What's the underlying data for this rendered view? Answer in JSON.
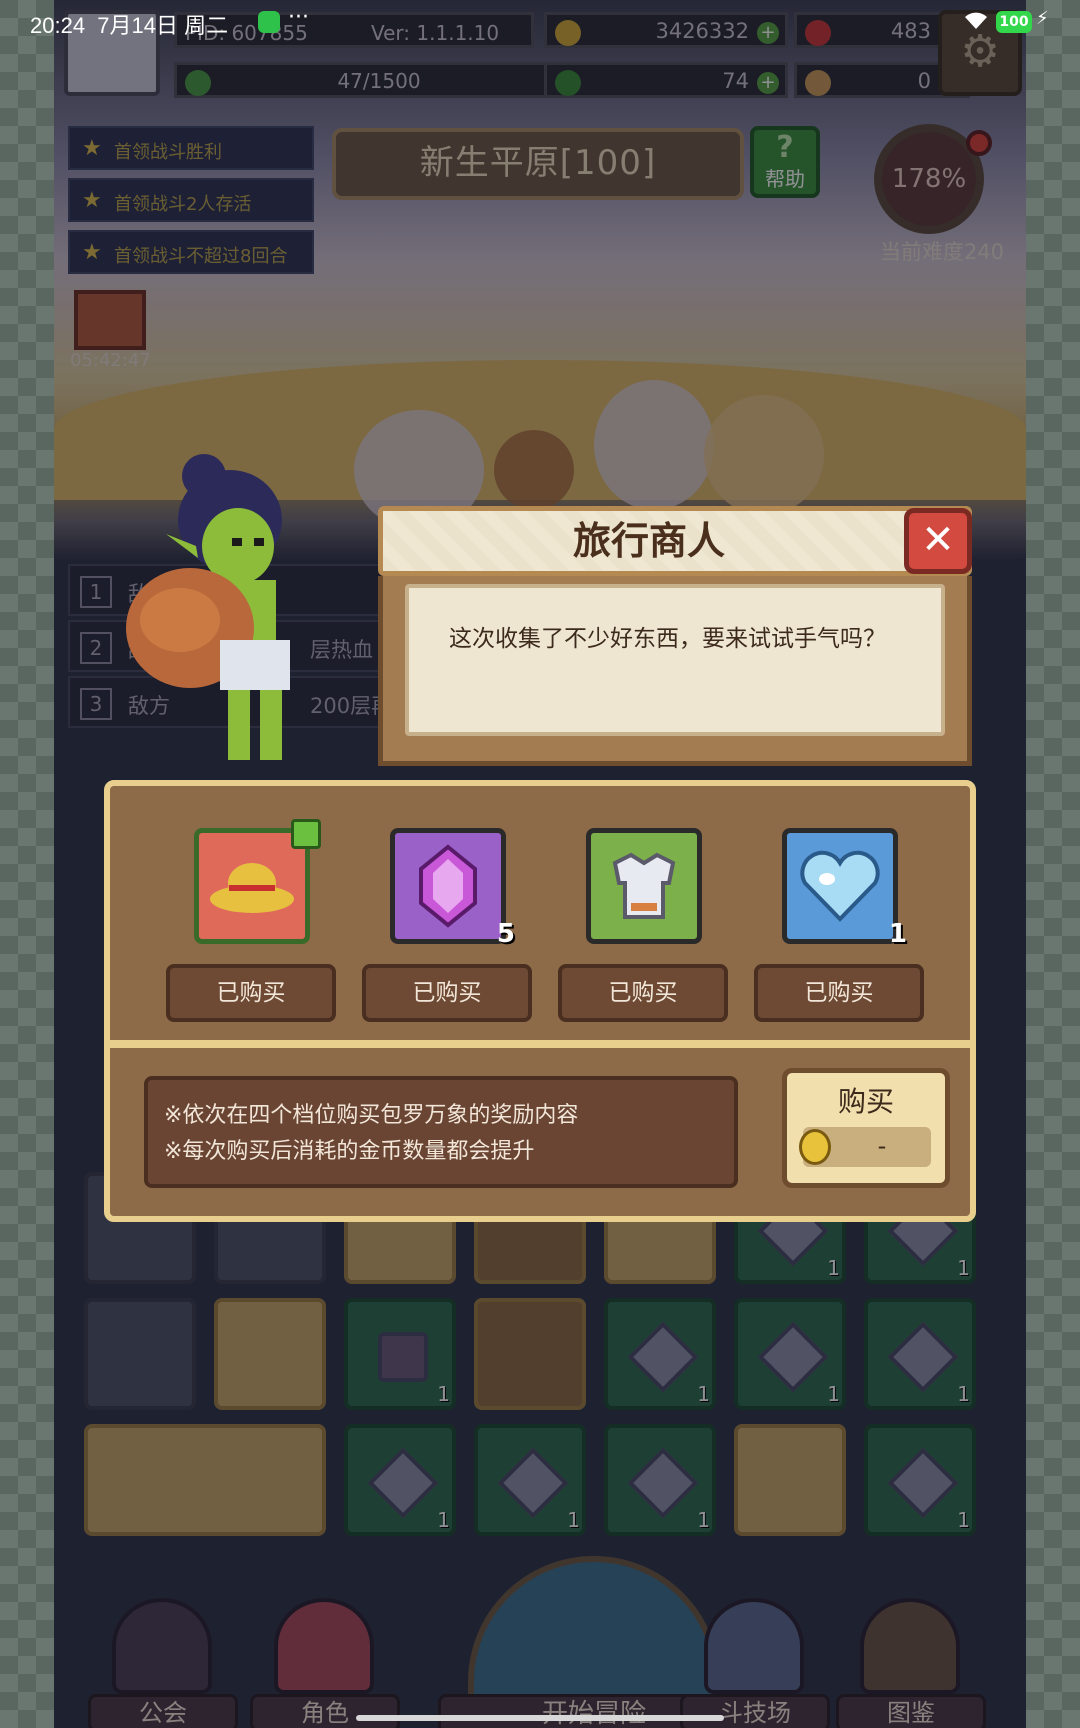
{
  "status_bar": {
    "time": "20:24",
    "date": "7月14日 周二",
    "dots": "···",
    "battery": "100"
  },
  "hud": {
    "pid": "PID: 607855",
    "version": "Ver: 1.1.1.10",
    "gold": "3426332",
    "gems": "483",
    "stamina": "47/1500",
    "clover": "74",
    "keys": "0"
  },
  "quests": [
    "首领战斗胜利",
    "首领战斗2人存活",
    "首领战斗不超过8回合"
  ],
  "stage": {
    "title": "新生平原[100]",
    "help_label": "帮助",
    "help_icon": "?"
  },
  "difficulty": {
    "percent": "178%",
    "label": "当前难度240"
  },
  "gift_timer": "05:42:47",
  "bg_rows": [
    {
      "n": "1",
      "text": "敌"
    },
    {
      "n": "2",
      "text": "敌方",
      "tail": "层热血"
    },
    {
      "n": "3",
      "text": "敌方",
      "tail": "200层再"
    }
  ],
  "merchant": {
    "title": "旅行商人",
    "message": "这次收集了不少好东西，要来试试手气吗？",
    "items": [
      {
        "name": "straw-hat",
        "color": "#e06a5a",
        "count": "",
        "sold_label": "已购买"
      },
      {
        "name": "purple-crystal",
        "color": "#9a62c8",
        "count": "5",
        "sold_label": "已购买"
      },
      {
        "name": "silver-armor",
        "color": "#7cb04a",
        "count": "",
        "sold_label": "已购买"
      },
      {
        "name": "blue-heart",
        "color": "#5a9ad8",
        "count": "1",
        "sold_label": "已购买"
      }
    ],
    "notes": [
      "※依次在四个档位购买包罗万象的奖励内容",
      "※每次购买后消耗的金币数量都会提升"
    ],
    "buy": {
      "label": "购买",
      "price": "-"
    }
  },
  "grid_numbers": [
    "1",
    "1",
    "1",
    "1",
    "1",
    "1",
    "1",
    "1",
    "1",
    "1",
    "1",
    "1"
  ],
  "nav": {
    "guild": "公会",
    "character": "角色",
    "start": "开始冒险",
    "arena": "斗技场",
    "codex": "图鉴"
  }
}
